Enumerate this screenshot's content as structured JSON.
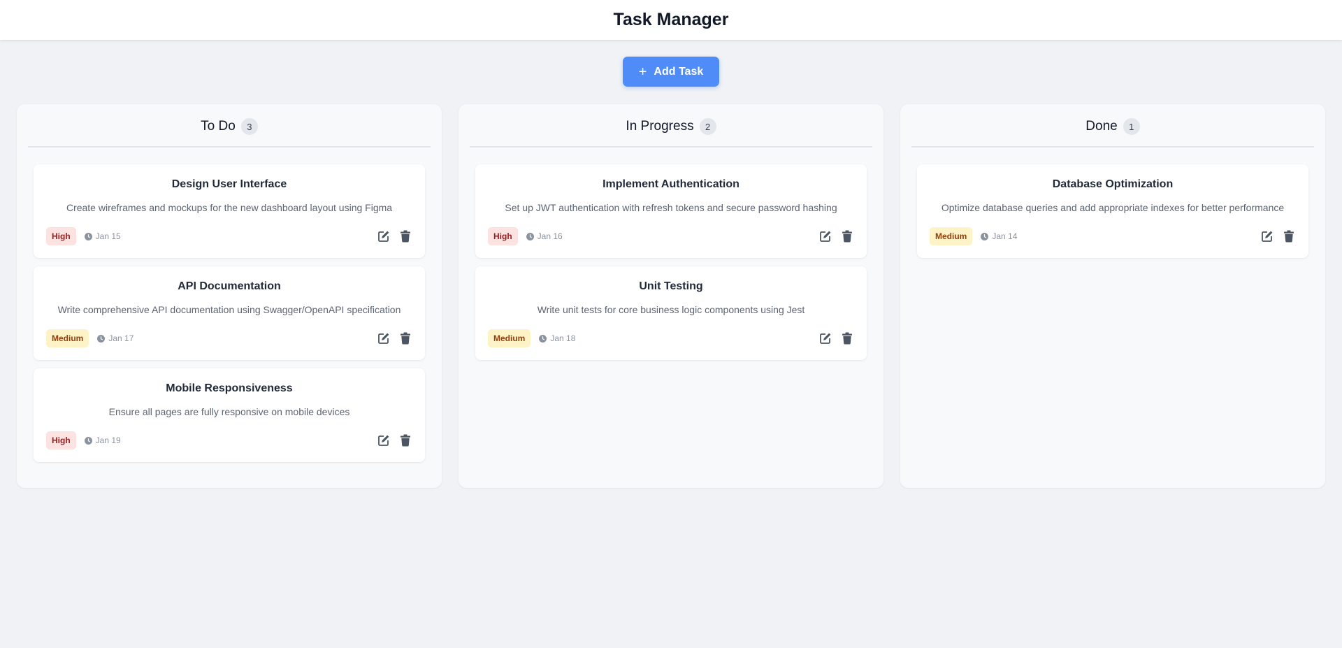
{
  "app": {
    "title": "Task Manager"
  },
  "toolbar": {
    "add_label": "Add Task"
  },
  "columns": [
    {
      "title": "To Do",
      "count": "3",
      "cards": [
        {
          "title": "Design User Interface",
          "description": "Create wireframes and mockups for the new dashboard layout using Figma",
          "priority": "High",
          "date": "Jan 15"
        },
        {
          "title": "API Documentation",
          "description": "Write comprehensive API documentation using Swagger/OpenAPI specification",
          "priority": "Medium",
          "date": "Jan 17"
        },
        {
          "title": "Mobile Responsiveness",
          "description": "Ensure all pages are fully responsive on mobile devices",
          "priority": "High",
          "date": "Jan 19"
        }
      ]
    },
    {
      "title": "In Progress",
      "count": "2",
      "cards": [
        {
          "title": "Implement Authentication",
          "description": "Set up JWT authentication with refresh tokens and secure password hashing",
          "priority": "High",
          "date": "Jan 16"
        },
        {
          "title": "Unit Testing",
          "description": "Write unit tests for core business logic components using Jest",
          "priority": "Medium",
          "date": "Jan 18"
        }
      ]
    },
    {
      "title": "Done",
      "count": "1",
      "cards": [
        {
          "title": "Database Optimization",
          "description": "Optimize database queries and add appropriate indexes for better performance",
          "priority": "Medium",
          "date": "Jan 14"
        }
      ]
    }
  ],
  "icons": {
    "add": "plus-icon",
    "date": "clock-icon",
    "edit": "edit-icon",
    "delete": "trash-icon"
  },
  "colors": {
    "accent": "#4f8cf7",
    "high_bg": "#fde2e2",
    "high_text": "#9b1c1c",
    "medium_bg": "#fef3c7",
    "medium_text": "#92400e"
  }
}
